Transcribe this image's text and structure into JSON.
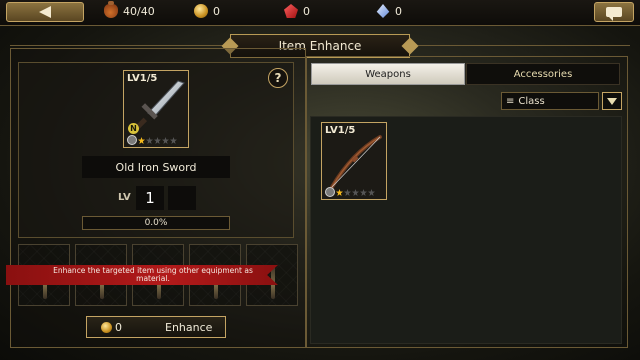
{
  "topbar": {
    "stamina": "40/40",
    "gold": "0",
    "rubies": "0",
    "crystals": "0",
    "back_icon": "back-arrow-icon",
    "chat_icon": "chat-bubble-icon"
  },
  "title": "Item Enhance",
  "detail": {
    "level_badge": "LV1/5",
    "rarity_badge": "N",
    "item_name": "Old Iron Sword",
    "lv_label": "LV",
    "lv_value": "1",
    "progress_text": "0.0%",
    "progress": 0.0,
    "stars_total": 5,
    "stars_filled": 1,
    "help_label": "?"
  },
  "material_slots": 5,
  "tooltip": "Enhance the targeted item using other equipment as material.",
  "enhance": {
    "cost": "0",
    "label": "Enhance"
  },
  "tabs": {
    "weapons": "Weapons",
    "accessories": "Accessories",
    "active": "weapons"
  },
  "filter": {
    "label": "Class",
    "icon": "list-icon"
  },
  "inventory": [
    {
      "level_badge": "LV1/5",
      "stars_filled": 1,
      "stars_total": 5,
      "icon": "bow-icon"
    }
  ],
  "colors": {
    "gold_accent": "#c4a463",
    "tooltip_red": "#b21a1a",
    "star_on": "#f5b91c"
  }
}
